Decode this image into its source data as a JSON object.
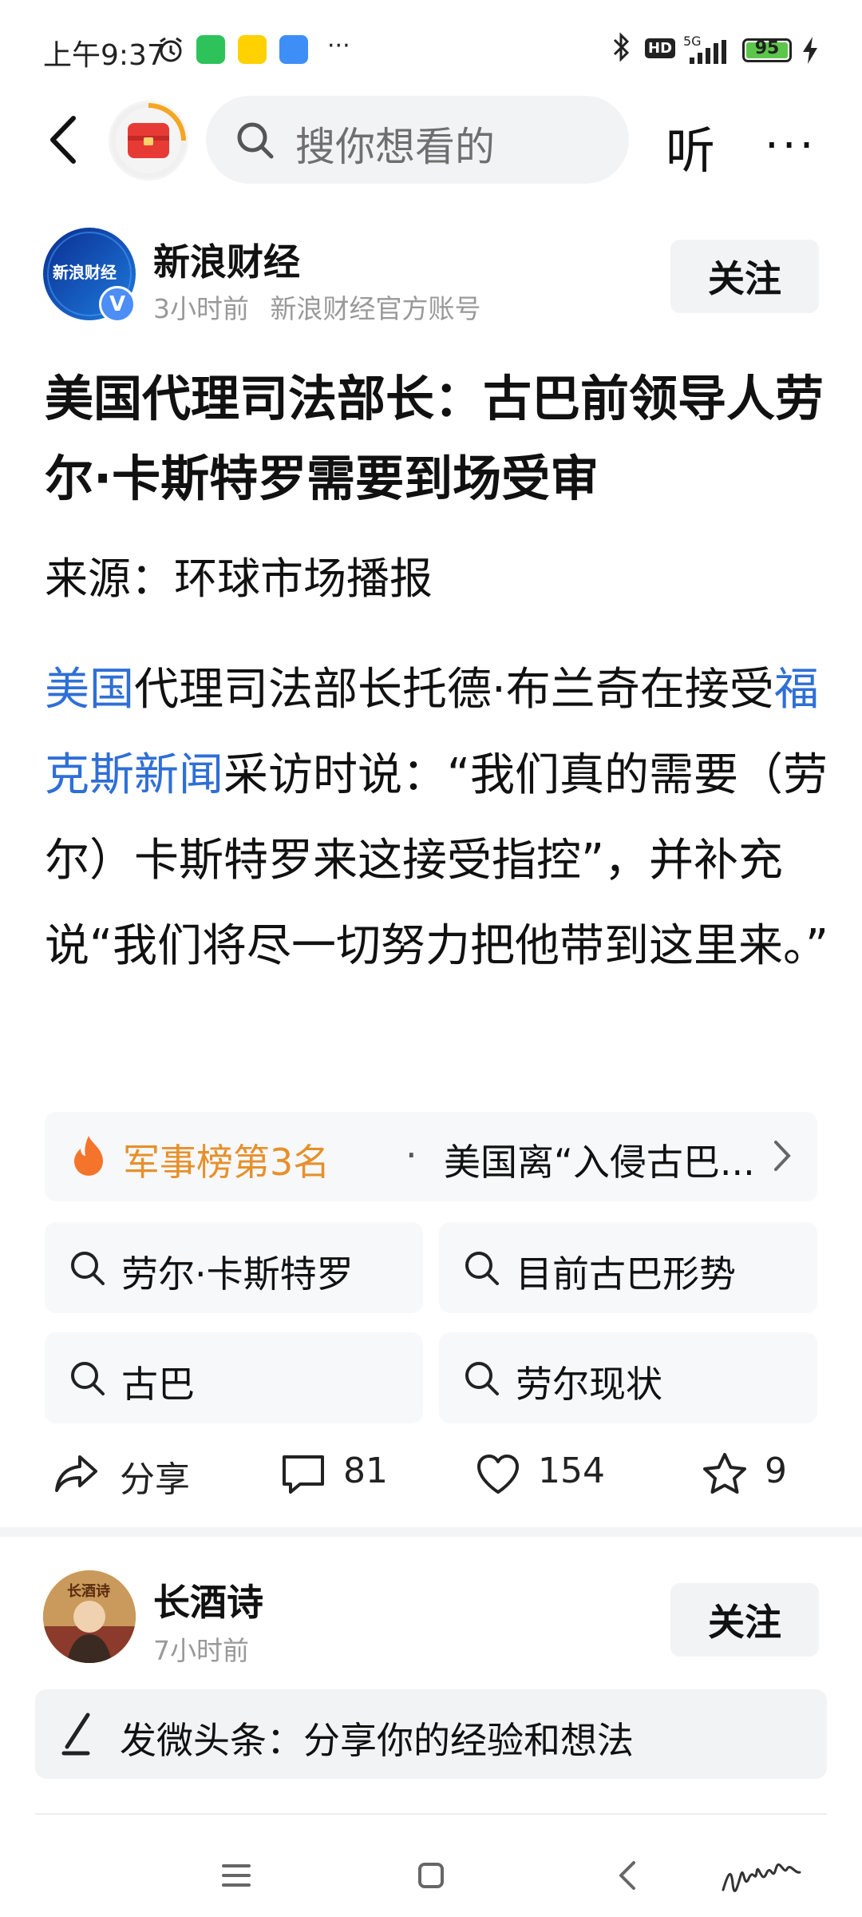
{
  "status_bar": {
    "time": "上午9:37",
    "signal_label": "5G",
    "hd_label": "HD",
    "battery": "95",
    "colors": {
      "wechat": "#2dc35a",
      "meituan": "#ffd100",
      "third_app": "#3e8ef7"
    }
  },
  "nav": {
    "search_placeholder": "搜你想看的",
    "listen_label": "听",
    "more_label": "···"
  },
  "author": {
    "name": "新浪财经",
    "time": "3小时前",
    "account": "新浪财经官方账号",
    "follow_label": "关注",
    "avatar_text": "新浪财经",
    "avatar_badge": "V"
  },
  "article": {
    "title": "美国代理司法部长：古巴前领导人劳尔·卡斯特罗需要到场受审",
    "source": "来源：环球市场播报",
    "body": {
      "link1": "美国",
      "text1": "代理司法部长托德·布兰奇在接受",
      "link2": "福克斯新闻",
      "text2": "采访时说：“我们真的需要（劳尔）卡斯特罗来这接受指控”，并补充说“我们将尽一切努力把他带到这里来。”"
    }
  },
  "hot_rank": {
    "rank_label": "军事榜第3名",
    "separator": "·",
    "topic": "美国离“入侵古巴...",
    "accent": "#e6902b"
  },
  "related_searches": [
    {
      "label": "劳尔·卡斯特罗"
    },
    {
      "label": "目前古巴形势"
    },
    {
      "label": "古巴"
    },
    {
      "label": "劳尔现状"
    }
  ],
  "actions": {
    "share_label": "分享",
    "comments": "81",
    "likes": "154",
    "favorites": "9"
  },
  "comment": {
    "name": "长酒诗",
    "time": "7小时前",
    "follow_label": "关注",
    "avatar_text": "长酒诗"
  },
  "compose": {
    "placeholder": "发微头条：分享你的经验和想法"
  }
}
